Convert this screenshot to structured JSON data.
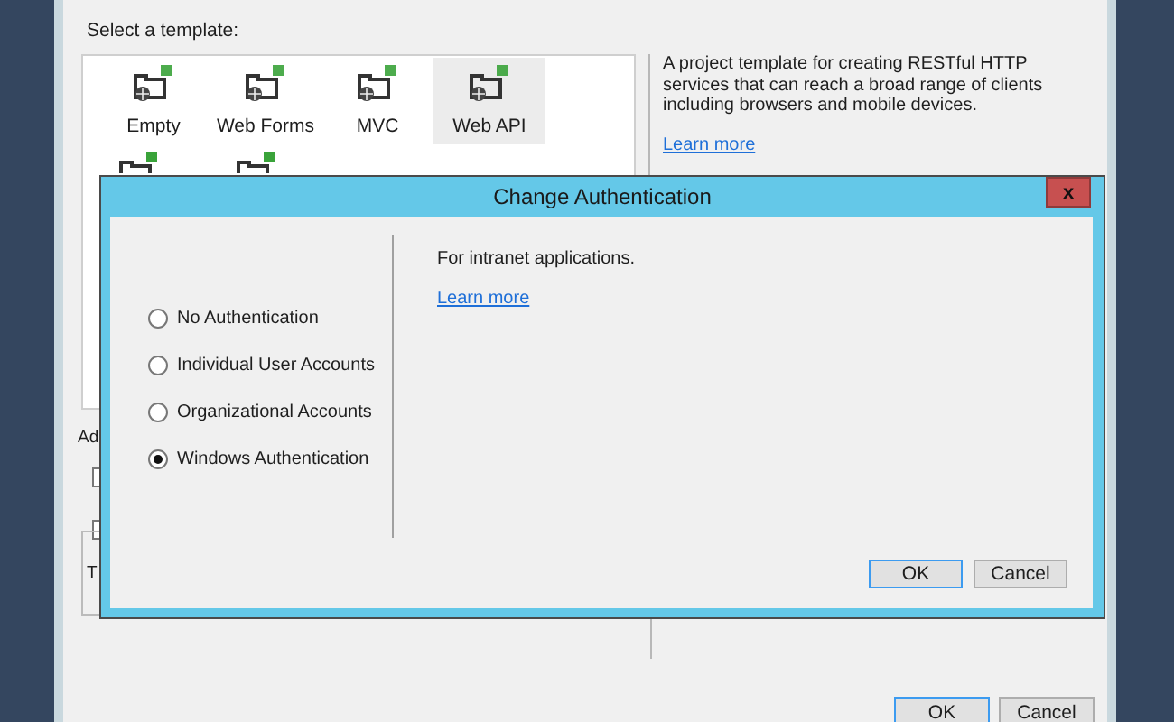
{
  "dialog": {
    "template_heading": "Select a template:",
    "templates": [
      {
        "label": "Empty",
        "selected": false
      },
      {
        "label": "Web Forms",
        "selected": false
      },
      {
        "label": "MVC",
        "selected": false
      },
      {
        "label": "Web API",
        "selected": true
      }
    ],
    "description": "A project template for creating RESTful HTTP services that can reach a broad range of clients including browsers and mobile devices.",
    "learn_more": "Learn more",
    "partial_label_1": "Ad",
    "partial_label_2": "T",
    "checkboxes": [
      {
        "checked": false
      },
      {
        "checked": false
      }
    ],
    "buttons": [
      "OK",
      "Cancel"
    ]
  },
  "modal": {
    "title": "Change Authentication",
    "close": "x",
    "options": [
      {
        "label": "No Authentication",
        "selected": false
      },
      {
        "label": "Individual User Accounts",
        "selected": false
      },
      {
        "label": "Organizational Accounts",
        "selected": false
      },
      {
        "label": "Windows Authentication",
        "selected": true
      }
    ],
    "description": "For intranet applications.",
    "learn_more": "Learn more",
    "buttons": [
      "OK",
      "Cancel"
    ]
  }
}
